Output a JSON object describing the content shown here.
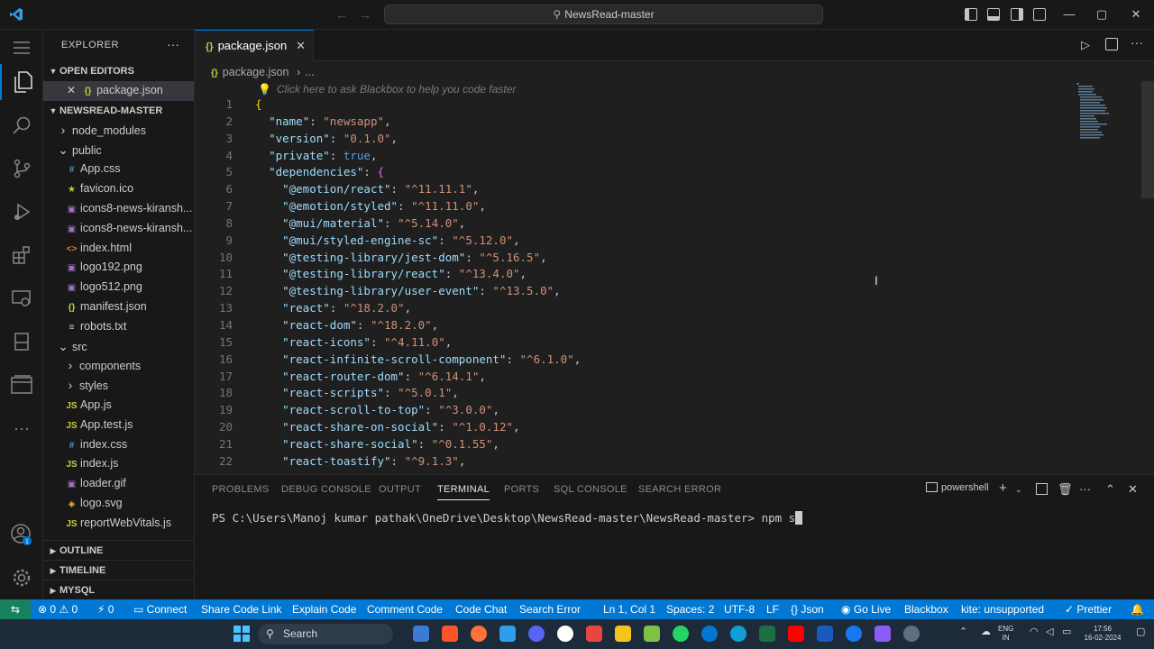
{
  "window": {
    "title": "NewsRead-master"
  },
  "sidebar": {
    "title": "EXPLORER",
    "open_editors_label": "OPEN EDITORS",
    "open_editor_file": "package.json",
    "project_label": "NEWSREAD-MASTER",
    "tree": [
      {
        "name": "node_modules",
        "icon": "chevron-right",
        "depth": 1
      },
      {
        "name": "public",
        "icon": "chevron-down",
        "depth": 1
      },
      {
        "name": "App.css",
        "icon": "#",
        "color": "#519aba",
        "depth": 2
      },
      {
        "name": "favicon.ico",
        "icon": "★",
        "color": "#cbcb41",
        "depth": 2
      },
      {
        "name": "icons8-news-kiransh...",
        "icon": "▣",
        "color": "#a074c4",
        "depth": 2
      },
      {
        "name": "icons8-news-kiransh...",
        "icon": "▣",
        "color": "#a074c4",
        "depth": 2
      },
      {
        "name": "index.html",
        "icon": "<>",
        "color": "#e37933",
        "depth": 2
      },
      {
        "name": "logo192.png",
        "icon": "▣",
        "color": "#a074c4",
        "depth": 2
      },
      {
        "name": "logo512.png",
        "icon": "▣",
        "color": "#a074c4",
        "depth": 2
      },
      {
        "name": "manifest.json",
        "icon": "{}",
        "color": "#cbcb41",
        "depth": 2
      },
      {
        "name": "robots.txt",
        "icon": "≡",
        "color": "#cccccc",
        "depth": 2
      },
      {
        "name": "src",
        "icon": "chevron-down",
        "depth": 1
      },
      {
        "name": "components",
        "icon": "chevron-right",
        "depth": 2
      },
      {
        "name": "styles",
        "icon": "chevron-right",
        "depth": 2
      },
      {
        "name": "App.js",
        "icon": "JS",
        "color": "#cbcb41",
        "depth": 2
      },
      {
        "name": "App.test.js",
        "icon": "JS",
        "color": "#cbcb41",
        "depth": 2
      },
      {
        "name": "index.css",
        "icon": "#",
        "color": "#519aba",
        "depth": 2
      },
      {
        "name": "index.js",
        "icon": "JS",
        "color": "#cbcb41",
        "depth": 2
      },
      {
        "name": "loader.gif",
        "icon": "▣",
        "color": "#a074c4",
        "depth": 2
      },
      {
        "name": "logo.svg",
        "icon": "◈",
        "color": "#ffb13b",
        "depth": 2
      },
      {
        "name": "reportWebVitals.js",
        "icon": "JS",
        "color": "#cbcb41",
        "depth": 2
      }
    ],
    "bottom_sections": [
      "OUTLINE",
      "TIMELINE",
      "MYSQL"
    ]
  },
  "editor": {
    "tab_label": "package.json",
    "breadcrumb_file": "package.json",
    "breadcrumb_more": "...",
    "hint": "Click here to ask Blackbox to help you code faster",
    "lines": [
      {
        "n": "1",
        "parts": [
          [
            "br",
            "{"
          ]
        ]
      },
      {
        "n": "2",
        "parts": [
          [
            "p",
            "  "
          ],
          [
            "k",
            "\"name\""
          ],
          [
            "p",
            ": "
          ],
          [
            "s",
            "\"newsapp\""
          ],
          [
            "p",
            ","
          ]
        ]
      },
      {
        "n": "3",
        "parts": [
          [
            "p",
            "  "
          ],
          [
            "k",
            "\"version\""
          ],
          [
            "p",
            ": "
          ],
          [
            "s",
            "\"0.1.0\""
          ],
          [
            "p",
            ","
          ]
        ]
      },
      {
        "n": "4",
        "parts": [
          [
            "p",
            "  "
          ],
          [
            "k",
            "\"private\""
          ],
          [
            "p",
            ": "
          ],
          [
            "b",
            "true"
          ],
          [
            "p",
            ","
          ]
        ]
      },
      {
        "n": "5",
        "parts": [
          [
            "p",
            "  "
          ],
          [
            "k",
            "\"dependencies\""
          ],
          [
            "p",
            ": "
          ],
          [
            "br2",
            "{"
          ]
        ]
      },
      {
        "n": "6",
        "parts": [
          [
            "p",
            "    "
          ],
          [
            "k",
            "\"@emotion/react\""
          ],
          [
            "p",
            ": "
          ],
          [
            "s",
            "\"^11.11.1\""
          ],
          [
            "p",
            ","
          ]
        ]
      },
      {
        "n": "7",
        "parts": [
          [
            "p",
            "    "
          ],
          [
            "k",
            "\"@emotion/styled\""
          ],
          [
            "p",
            ": "
          ],
          [
            "s",
            "\"^11.11.0\""
          ],
          [
            "p",
            ","
          ]
        ]
      },
      {
        "n": "8",
        "parts": [
          [
            "p",
            "    "
          ],
          [
            "k",
            "\"@mui/material\""
          ],
          [
            "p",
            ": "
          ],
          [
            "s",
            "\"^5.14.0\""
          ],
          [
            "p",
            ","
          ]
        ]
      },
      {
        "n": "9",
        "parts": [
          [
            "p",
            "    "
          ],
          [
            "k",
            "\"@mui/styled-engine-sc\""
          ],
          [
            "p",
            ": "
          ],
          [
            "s",
            "\"^5.12.0\""
          ],
          [
            "p",
            ","
          ]
        ]
      },
      {
        "n": "10",
        "parts": [
          [
            "p",
            "    "
          ],
          [
            "k",
            "\"@testing-library/jest-dom\""
          ],
          [
            "p",
            ": "
          ],
          [
            "s",
            "\"^5.16.5\""
          ],
          [
            "p",
            ","
          ]
        ]
      },
      {
        "n": "11",
        "parts": [
          [
            "p",
            "    "
          ],
          [
            "k",
            "\"@testing-library/react\""
          ],
          [
            "p",
            ": "
          ],
          [
            "s",
            "\"^13.4.0\""
          ],
          [
            "p",
            ","
          ]
        ]
      },
      {
        "n": "12",
        "parts": [
          [
            "p",
            "    "
          ],
          [
            "k",
            "\"@testing-library/user-event\""
          ],
          [
            "p",
            ": "
          ],
          [
            "s",
            "\"^13.5.0\""
          ],
          [
            "p",
            ","
          ]
        ]
      },
      {
        "n": "13",
        "parts": [
          [
            "p",
            "    "
          ],
          [
            "k",
            "\"react\""
          ],
          [
            "p",
            ": "
          ],
          [
            "s",
            "\"^18.2.0\""
          ],
          [
            "p",
            ","
          ]
        ]
      },
      {
        "n": "14",
        "parts": [
          [
            "p",
            "    "
          ],
          [
            "k",
            "\"react-dom\""
          ],
          [
            "p",
            ": "
          ],
          [
            "s",
            "\"^18.2.0\""
          ],
          [
            "p",
            ","
          ]
        ]
      },
      {
        "n": "15",
        "parts": [
          [
            "p",
            "    "
          ],
          [
            "k",
            "\"react-icons\""
          ],
          [
            "p",
            ": "
          ],
          [
            "s",
            "\"^4.11.0\""
          ],
          [
            "p",
            ","
          ]
        ]
      },
      {
        "n": "16",
        "parts": [
          [
            "p",
            "    "
          ],
          [
            "k",
            "\"react-infinite-scroll-component\""
          ],
          [
            "p",
            ": "
          ],
          [
            "s",
            "\"^6.1.0\""
          ],
          [
            "p",
            ","
          ]
        ]
      },
      {
        "n": "17",
        "parts": [
          [
            "p",
            "    "
          ],
          [
            "k",
            "\"react-router-dom\""
          ],
          [
            "p",
            ": "
          ],
          [
            "s",
            "\"^6.14.1\""
          ],
          [
            "p",
            ","
          ]
        ]
      },
      {
        "n": "18",
        "parts": [
          [
            "p",
            "    "
          ],
          [
            "k",
            "\"react-scripts\""
          ],
          [
            "p",
            ": "
          ],
          [
            "s",
            "\"^5.0.1\""
          ],
          [
            "p",
            ","
          ]
        ]
      },
      {
        "n": "19",
        "parts": [
          [
            "p",
            "    "
          ],
          [
            "k",
            "\"react-scroll-to-top\""
          ],
          [
            "p",
            ": "
          ],
          [
            "s",
            "\"^3.0.0\""
          ],
          [
            "p",
            ","
          ]
        ]
      },
      {
        "n": "20",
        "parts": [
          [
            "p",
            "    "
          ],
          [
            "k",
            "\"react-share-on-social\""
          ],
          [
            "p",
            ": "
          ],
          [
            "s",
            "\"^1.0.12\""
          ],
          [
            "p",
            ","
          ]
        ]
      },
      {
        "n": "21",
        "parts": [
          [
            "p",
            "    "
          ],
          [
            "k",
            "\"react-share-social\""
          ],
          [
            "p",
            ": "
          ],
          [
            "s",
            "\"^0.1.55\""
          ],
          [
            "p",
            ","
          ]
        ]
      },
      {
        "n": "22",
        "parts": [
          [
            "p",
            "    "
          ],
          [
            "k",
            "\"react-toastify\""
          ],
          [
            "p",
            ": "
          ],
          [
            "s",
            "\"^9.1.3\""
          ],
          [
            "p",
            ","
          ]
        ]
      }
    ]
  },
  "panel": {
    "tabs": [
      "PROBLEMS",
      "DEBUG CONSOLE",
      "OUTPUT",
      "TERMINAL",
      "PORTS",
      "SQL CONSOLE",
      "SEARCH ERROR"
    ],
    "active_tab": "TERMINAL",
    "shell": "powershell",
    "prompt": "PS C:\\Users\\Manoj kumar pathak\\OneDrive\\Desktop\\NewsRead-master\\NewsRead-master> ",
    "command": "npm s"
  },
  "statusbar": {
    "errors": "0",
    "warnings": "0",
    "ports": "0",
    "left_items": [
      "Connect",
      "Share Code Link",
      "Explain Code",
      "Comment Code",
      "Code Chat",
      "Search Error"
    ],
    "cursor": "Ln 1, Col 1",
    "spaces": "Spaces: 2",
    "encoding": "UTF-8",
    "eol": "LF",
    "language": "Json",
    "golive": "Go Live",
    "blackbox": "Blackbox",
    "kite": "kite: unsupported",
    "prettier": "Prettier"
  },
  "taskbar": {
    "search_label": "Search",
    "lang": "ENG",
    "region": "IN",
    "time": "17:56",
    "date": "16-02-2024"
  },
  "colors": {
    "accent": "#0078d4",
    "remote": "#16825d"
  }
}
